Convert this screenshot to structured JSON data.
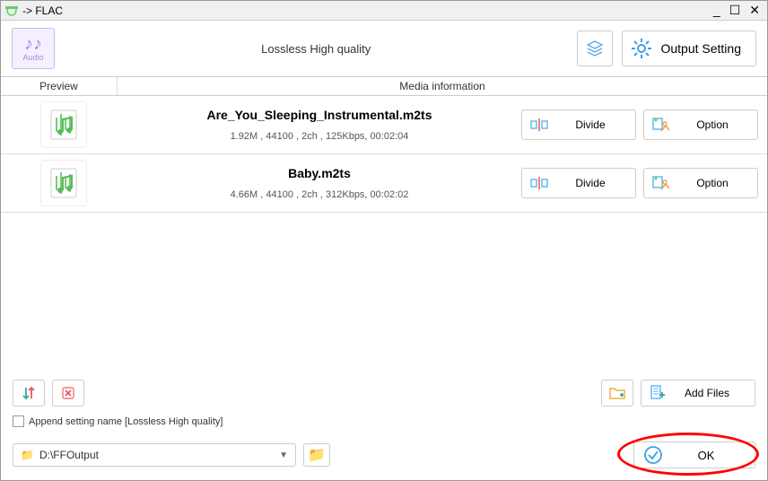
{
  "window": {
    "title": "-> FLAC",
    "minimize": "_",
    "maximize": "☐",
    "close": "✕"
  },
  "toolbar": {
    "audio_badge": "Audio",
    "quality_label": "Lossless High quality",
    "output_setting": "Output Setting"
  },
  "table": {
    "col_preview": "Preview",
    "col_media": "Media information"
  },
  "files": [
    {
      "name": "Are_You_Sleeping_Instrumental.m2ts",
      "details": "1.92M , 44100 , 2ch , 125Kbps, 00:02:04",
      "divide_label": "Divide",
      "option_label": "Option"
    },
    {
      "name": "Baby.m2ts",
      "details": "4.66M , 44100 , 2ch , 312Kbps, 00:02:02",
      "divide_label": "Divide",
      "option_label": "Option"
    }
  ],
  "bottom": {
    "append_label": "Append setting name [Lossless High quality]",
    "add_files": "Add Files",
    "output_path": "D:\\FFOutput",
    "ok": "OK"
  },
  "icons": {
    "folder": "📁",
    "note": "♪♪"
  }
}
